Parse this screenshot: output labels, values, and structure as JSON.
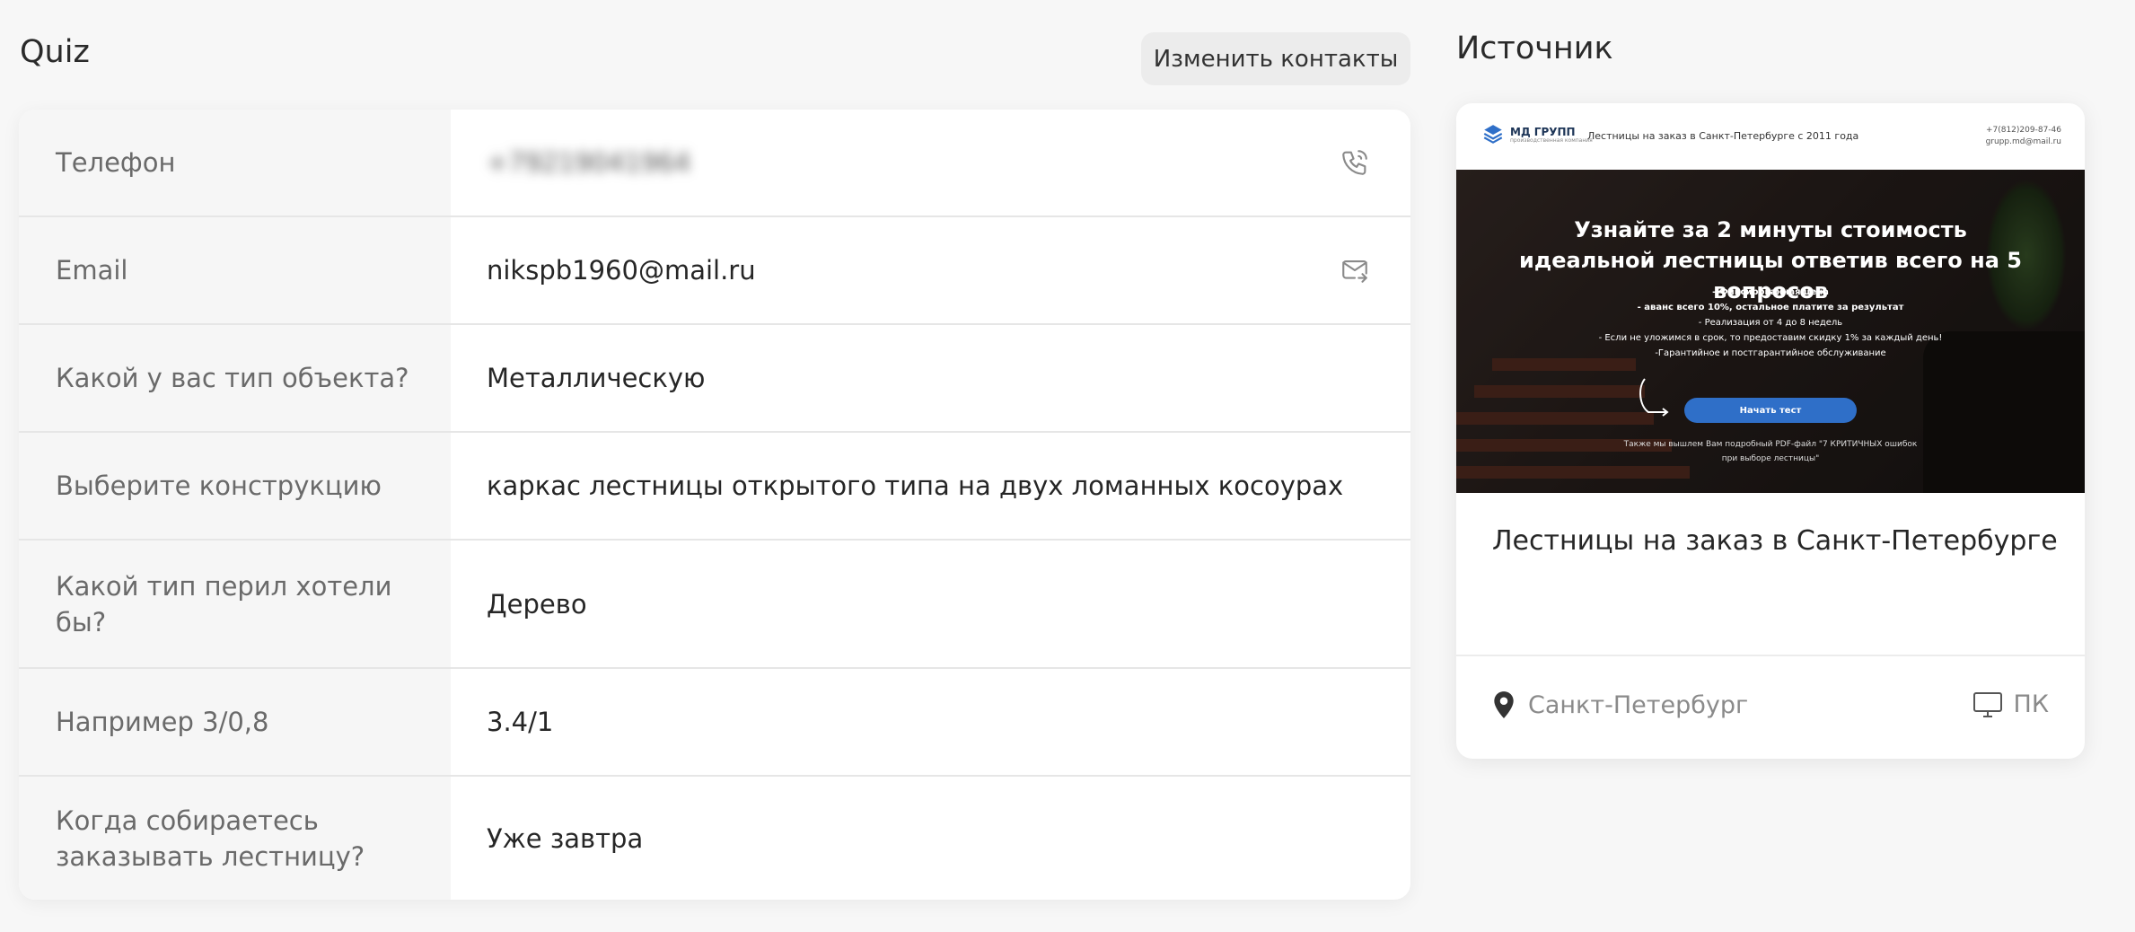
{
  "quiz": {
    "title": "Quiz",
    "edit_button": "Изменить контакты",
    "rows": [
      {
        "label": "Телефон",
        "value": "+79219041964"
      },
      {
        "label": "Email",
        "value": "nikspb1960@mail.ru"
      },
      {
        "label": "Какой у вас тип объекта?",
        "value": "Металлическую"
      },
      {
        "label": "Выберите конструкцию",
        "value": "каркас лестницы открытого типа на двух ломанных косоурах"
      },
      {
        "label": "Какой тип перил хотели бы?",
        "value": "Дерево"
      },
      {
        "label": "Например 3/0,8",
        "value": "3.4/1"
      },
      {
        "label": "Когда собираетесь заказывать лестницу?",
        "value": "Уже завтра"
      }
    ],
    "icons": {
      "phone": "phone-call-icon",
      "email": "mail-forward-icon"
    }
  },
  "source": {
    "title": "Источник",
    "preview": {
      "logo": "МД ГРУПП",
      "logo_sub": "производственная компания",
      "tagline": "Лестницы на заказ в Санкт-Петербурге с 2011 года",
      "phone": "+7(812)209-87-46",
      "email": "grupp.md@mail.ru",
      "heading": "Узнайте за 2 минуты стоимость идеальной лестницы ответив всего на 5 вопросов",
      "bullets": [
        "- Фиксированная цена",
        "- аванс всего 10%, остальное платите за результат",
        "- Реализация от 4 до 8 недель",
        "- Если не уложимся в срок, то предоставим скидку 1% за каждый день!",
        "-Гарантийное и постгарантийное обслуживание"
      ],
      "cta": "Начать тест",
      "note": "Также мы вышлем Вам подробный PDF-файл \"7 КРИТИЧНЫХ ошибок при выборе лестницы\""
    },
    "name": "Лестницы на заказ в Санкт-Петербурге",
    "location": "Санкт-Петербург",
    "device": "ПК",
    "icons": {
      "location": "map-pin-icon",
      "device": "monitor-icon"
    }
  }
}
